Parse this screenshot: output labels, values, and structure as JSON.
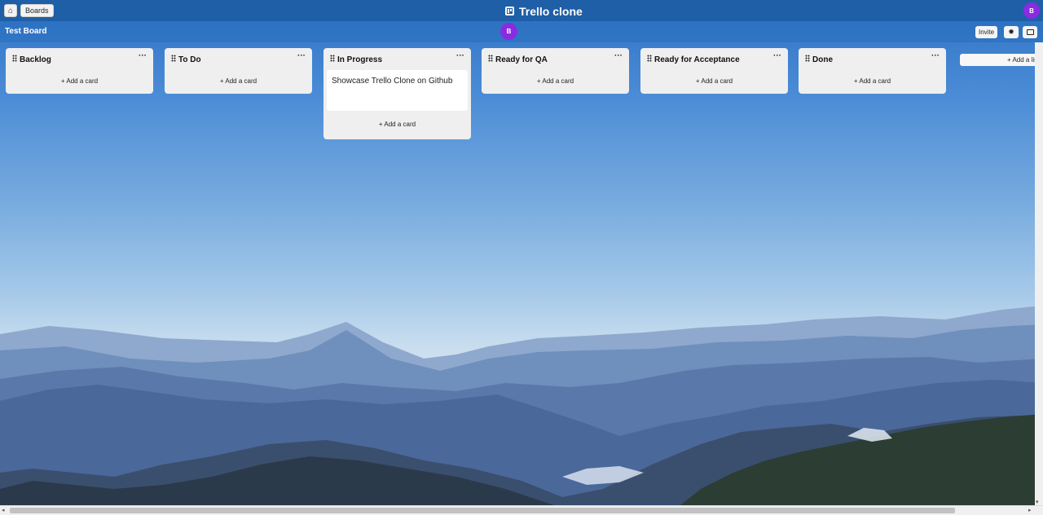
{
  "topbar": {
    "home_icon": "home-icon",
    "boards_label": "Boards",
    "app_title": "Trello clone",
    "avatar_initial": "B"
  },
  "board": {
    "title": "Test Board",
    "member_initial": "B",
    "invite_label": "Invite",
    "settings_icon": "gear-icon",
    "background_icon": "image-icon"
  },
  "lists": [
    {
      "title": "Backlog",
      "cards": [],
      "add_label": "+ Add a card"
    },
    {
      "title": "To Do",
      "cards": [],
      "add_label": "+ Add a card"
    },
    {
      "title": "In Progress",
      "cards": [
        "Showcase Trello Clone on Github"
      ],
      "add_label": "+ Add a card"
    },
    {
      "title": "Ready for QA",
      "cards": [],
      "add_label": "+ Add a card"
    },
    {
      "title": "Ready for Acceptance",
      "cards": [],
      "add_label": "+ Add a card"
    },
    {
      "title": "Done",
      "cards": [],
      "add_label": "+ Add a card"
    }
  ],
  "add_list_label": "+ Add a list",
  "menu_glyph": "···",
  "colors": {
    "topbar": "#1f5fa8",
    "avatar": "#8a2be2",
    "list_bg": "#efefef"
  }
}
